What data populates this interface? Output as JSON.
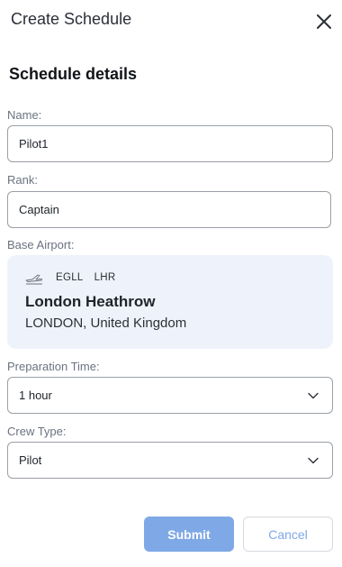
{
  "header": {
    "title": "Create Schedule",
    "close_icon": "close-icon"
  },
  "section": {
    "title": "Schedule details"
  },
  "form": {
    "name": {
      "label": "Name:",
      "value": "Pilot1"
    },
    "rank": {
      "label": "Rank:",
      "value": "Captain"
    },
    "base_airport": {
      "label": "Base Airport:",
      "icon": "plane-departure-icon",
      "icao": "EGLL",
      "iata": "LHR",
      "name": "London Heathrow",
      "city": "LONDON, United Kingdom"
    },
    "preparation_time": {
      "label": "Preparation Time:",
      "value": "1 hour"
    },
    "crew_type": {
      "label": "Crew Type:",
      "value": "Pilot"
    }
  },
  "actions": {
    "submit_label": "Submit",
    "cancel_label": "Cancel"
  },
  "colors": {
    "accent": "#7fa8e6",
    "card_bg": "#eef3fb",
    "border": "#9aa0a6"
  }
}
